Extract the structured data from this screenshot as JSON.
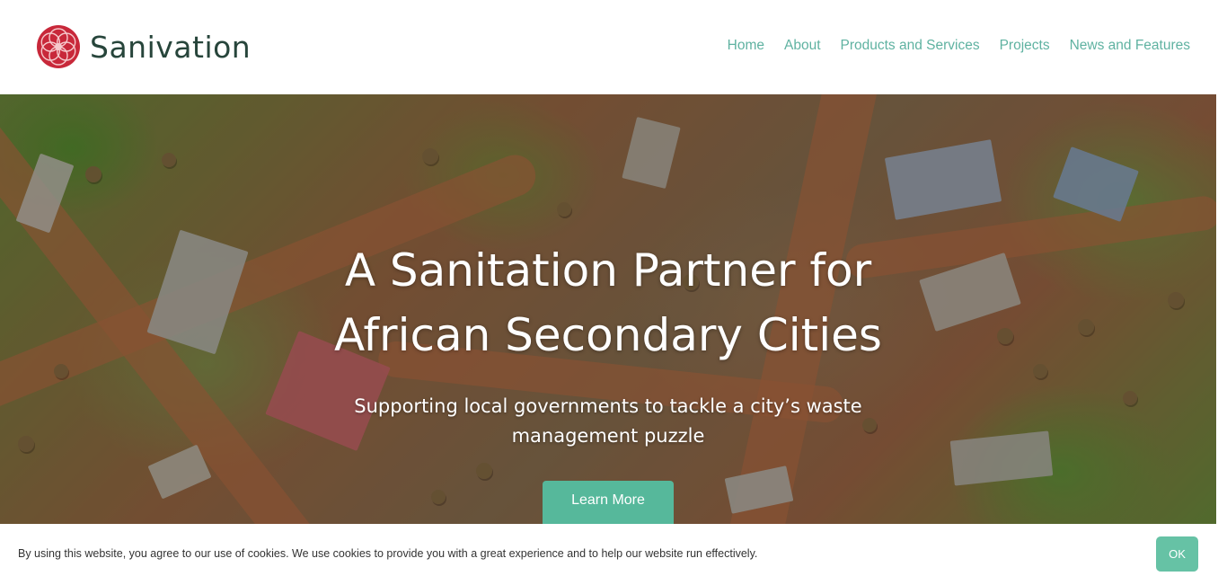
{
  "brand": {
    "name": "Sanivation",
    "logo_icon": "flower-logo-icon",
    "logo_color": "#d1323b",
    "text_color": "#27453b"
  },
  "nav": {
    "items": [
      {
        "label": "Home"
      },
      {
        "label": "About"
      },
      {
        "label": "Products and Services"
      },
      {
        "label": "Projects"
      },
      {
        "label": "News and Features"
      }
    ],
    "color": "#5fb2a1"
  },
  "hero": {
    "title_line1": "A Sanitation Partner for",
    "title_line2": "African Secondary Cities",
    "subtitle_line1": "Supporting local governments to tackle a city’s waste",
    "subtitle_line2": "management puzzle",
    "button_label": "Learn More",
    "button_color": "#56b89b",
    "image_description": "aerial-photo-of-town"
  },
  "cookie": {
    "message": "By using this website, you agree to our use of cookies. We use cookies to provide you with a great experience and to help our website run effectively.",
    "ok_label": "OK",
    "ok_color": "#66c2a5"
  }
}
